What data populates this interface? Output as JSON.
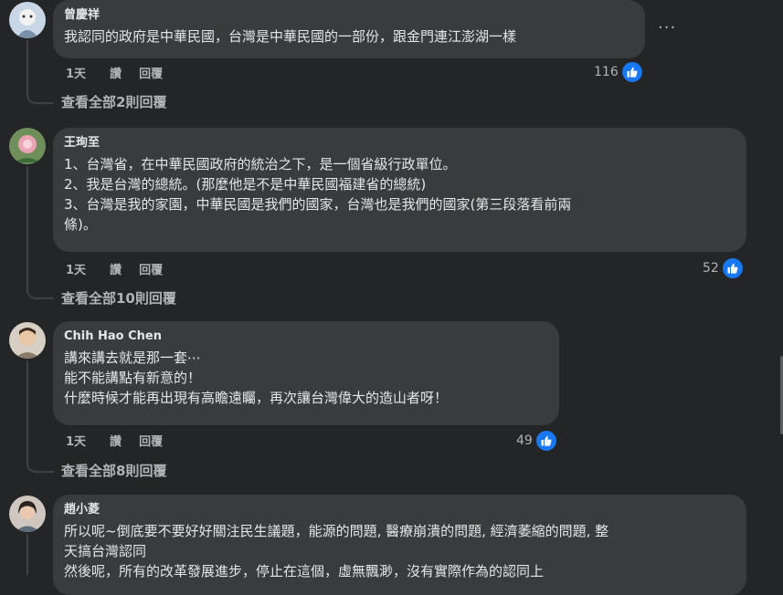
{
  "comments": [
    {
      "author": "曾慶祥",
      "lines": [
        "我認同的政府是中華民國，台灣是中華民國的一部份，跟金門連江澎湖一樣"
      ],
      "time": "1天",
      "like": "讚",
      "reply": "回覆",
      "reaction_count": "116",
      "view_replies": "查看全部2則回覆",
      "more": "···"
    },
    {
      "author": "王珣至",
      "lines": [
        "1、台灣省，在中華民國政府的統治之下，是一個省級行政單位。",
        "2、我是台灣的總統。(那麼他是不是中華民國福建省的總統)",
        "3、台灣是我的家園，中華民國是我們的國家，台灣也是我們的國家(第三段落看前兩",
        "條)。"
      ],
      "time": "1天",
      "like": "讚",
      "reply": "回覆",
      "reaction_count": "52",
      "view_replies": "查看全部10則回覆"
    },
    {
      "author": "Chih Hao Chen",
      "lines": [
        "講來講去就是那一套⋯",
        "能不能講點有新意的！",
        "什麼時候才能再出現有高瞻遠矚，再次讓台灣偉大的造山者呀！"
      ],
      "time": "1天",
      "like": "讚",
      "reply": "回覆",
      "reaction_count": "49",
      "view_replies": "查看全部8則回覆"
    },
    {
      "author": "趙小菱",
      "lines": [
        "所以呢~倒底要不要好好關注民生議題，能源的問題, 醫療崩潰的問題, 經濟萎縮的問題, 整",
        "天搞台灣認同",
        "然後呢，所有的改革發展進步，停止在這個，虛無飄渺，沒有實際作為的認同上"
      ]
    }
  ],
  "colors": {
    "background": "#242526",
    "bubble": "#3a3b3c",
    "like_badge": "#1877f2",
    "muted_text": "#b0b3b8"
  }
}
